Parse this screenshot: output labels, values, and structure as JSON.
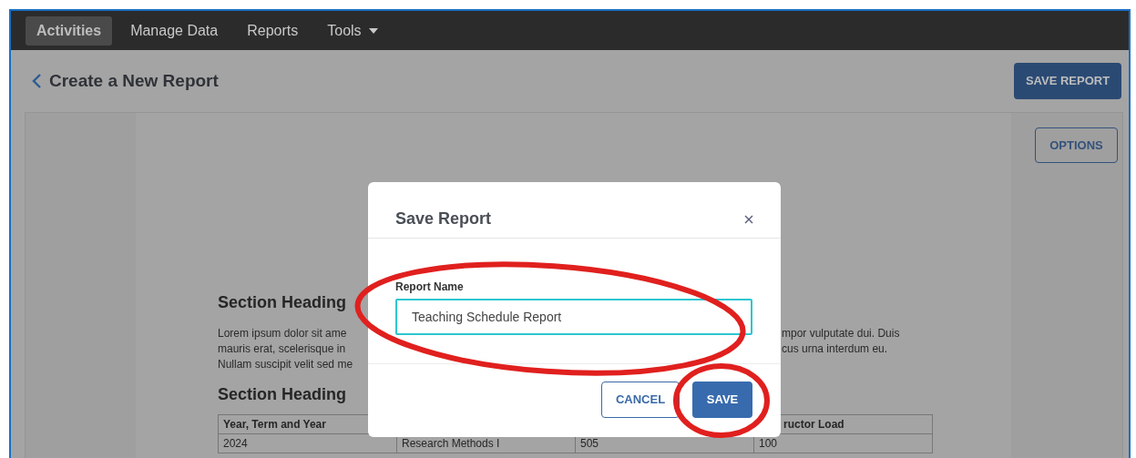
{
  "nav": {
    "items": [
      {
        "label": "Activities",
        "selected": true,
        "dropdown": false
      },
      {
        "label": "Manage Data",
        "selected": false,
        "dropdown": false
      },
      {
        "label": "Reports",
        "selected": false,
        "dropdown": false
      },
      {
        "label": "Tools",
        "selected": false,
        "dropdown": true
      }
    ]
  },
  "page": {
    "title": "Create a New Report",
    "save_button": "SAVE REPORT",
    "options_button": "OPTIONS"
  },
  "report": {
    "sections": [
      {
        "heading": "Section Heading",
        "paragraph_left": [
          "Lorem ipsum dolor sit ame",
          "mauris erat, scelerisque in",
          "Nullam suscipit velit sed me"
        ],
        "paragraph_right": [
          "mpor vulputate dui. Duis",
          "cus urna interdum eu."
        ]
      },
      {
        "heading": "Section Heading"
      }
    ],
    "table": {
      "columns": [
        {
          "label": "Year, Term and Year"
        },
        {},
        {},
        {
          "label": "ructor Load"
        }
      ],
      "rows": [
        [
          "2024",
          "Research Methods I",
          "505",
          "100"
        ]
      ]
    }
  },
  "modal": {
    "title": "Save Report",
    "field_label": "Report Name",
    "field_value": "Teaching Schedule Report",
    "buttons": [
      {
        "label": "CANCEL",
        "kind": "secondary"
      },
      {
        "label": "SAVE",
        "kind": "primary"
      }
    ]
  }
}
